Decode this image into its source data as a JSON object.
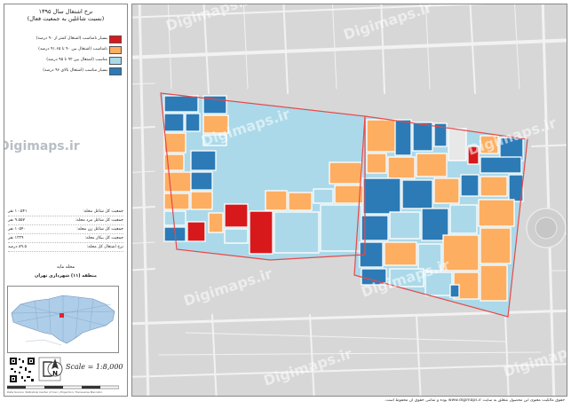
{
  "legend": {
    "title_line1": "نرخ اشتغال سال ۱۳۹۵",
    "title_line2": "(نسبت شاغلین به جمعیت فعال)",
    "classes": [
      {
        "label": "بسیار نامناسب (اشتغال کمتر از ۹۰ درصد)",
        "color": "#d7191c"
      },
      {
        "label": "نامناسب (اشتغال بین ۹۰ تا ۹۱.۶۵ درصد)",
        "color": "#fdae61"
      },
      {
        "label": "مناسب (اشتغال بین ۹۲ تا ۹۵ درصد)",
        "color": "#abd9e9"
      },
      {
        "label": "بسیار مناسب (اشتغال بالای ۹۶ درصد)",
        "color": "#2c7bb6"
      }
    ]
  },
  "stats": [
    {
      "label": "جمعیت کل شاغل محله:",
      "value": "۱۰.۵۴۱ نفر"
    },
    {
      "label": "جمعیت کل شاغل مرد محله:",
      "value": "۹.۵۵۷ نفر"
    },
    {
      "label": "جمعیت کل شاغل زن محله:",
      "value": "۱۰۵۴۰ نفر"
    },
    {
      "label": "جمعیت کل بیکار محله:",
      "value": "۱۲۲۹ نفر"
    },
    {
      "label": "نرخ اشتغال کل محله:",
      "value": "۸۹.۵ درصد"
    }
  ],
  "location": {
    "line1": "محله مایه",
    "line2": "منطقه (۱۱) شهرداری تهران"
  },
  "scale": {
    "text": "Scale = 1:8,000"
  },
  "compass_letter": "N",
  "watermark": "Digimaps.ir",
  "footer": "حقوق مالکیت معنوی این محصول متعلق به سایت www.digimaps.ir بوده و تمامی حقوق آن محفوظ است.",
  "small_credit": "Data Source: Statistical Center of Iran | Projection: Transverse Mercator",
  "colors": {
    "very_poor": "#d7191c",
    "poor": "#fdae61",
    "good": "#abd9e9",
    "very_good": "#2c7bb6",
    "boundary": "#e8484a",
    "background": "#d7d7d7"
  }
}
